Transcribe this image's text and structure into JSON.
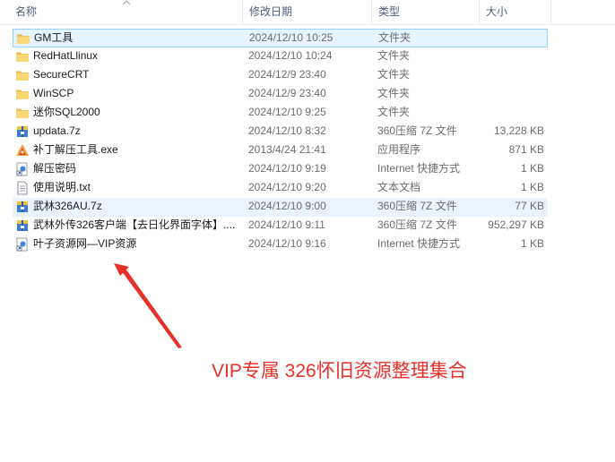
{
  "columns": {
    "name": "名称",
    "date": "修改日期",
    "type": "类型",
    "size": "大小"
  },
  "files": [
    {
      "name": "GM工具",
      "date": "2024/12/10 10:25",
      "type": "文件夹",
      "size": "",
      "icon": "folder-icon",
      "state": "selected"
    },
    {
      "name": "RedHatLlinux",
      "date": "2024/12/10 10:24",
      "type": "文件夹",
      "size": "",
      "icon": "folder-icon",
      "state": ""
    },
    {
      "name": "SecureCRT",
      "date": "2024/12/9 23:40",
      "type": "文件夹",
      "size": "",
      "icon": "folder-icon",
      "state": ""
    },
    {
      "name": "WinSCP",
      "date": "2024/12/9 23:40",
      "type": "文件夹",
      "size": "",
      "icon": "folder-icon",
      "state": ""
    },
    {
      "name": "迷你SQL2000",
      "date": "2024/12/10 9:25",
      "type": "文件夹",
      "size": "",
      "icon": "folder-icon",
      "state": ""
    },
    {
      "name": "updata.7z",
      "date": "2024/12/10 8:32",
      "type": "360压缩 7Z 文件",
      "size": "13,228 KB",
      "icon": "archive-icon",
      "state": ""
    },
    {
      "name": "补丁解压工具.exe",
      "date": "2013/4/24 21:41",
      "type": "应用程序",
      "size": "871 KB",
      "icon": "exe-icon",
      "state": ""
    },
    {
      "name": "解压密码",
      "date": "2024/12/10 9:19",
      "type": "Internet 快捷方式",
      "size": "1 KB",
      "icon": "url-shortcut-icon",
      "state": ""
    },
    {
      "name": "使用说明.txt",
      "date": "2024/12/10 9:20",
      "type": "文本文档",
      "size": "1 KB",
      "icon": "text-file-icon",
      "state": ""
    },
    {
      "name": "武林326AU.7z",
      "date": "2024/12/10 9:00",
      "type": "360压缩 7Z 文件",
      "size": "77 KB",
      "icon": "archive-icon",
      "state": "hover"
    },
    {
      "name": "武林外传326客户端【去日化界面字体】....",
      "date": "2024/12/10 9:11",
      "type": "360压缩 7Z 文件",
      "size": "952,297 KB",
      "icon": "archive-icon",
      "state": ""
    },
    {
      "name": "叶子资源网—VIP资源",
      "date": "2024/12/10 9:16",
      "type": "Internet 快捷方式",
      "size": "1 KB",
      "icon": "url-shortcut-icon",
      "state": ""
    }
  ],
  "annotation": {
    "text": "VIP专属 326怀旧资源整理集合",
    "color": "#e8302a"
  },
  "colors": {
    "selected_bg": "#e5f3ff",
    "selected_border": "#99d1ff",
    "folder": "#f8d775"
  }
}
